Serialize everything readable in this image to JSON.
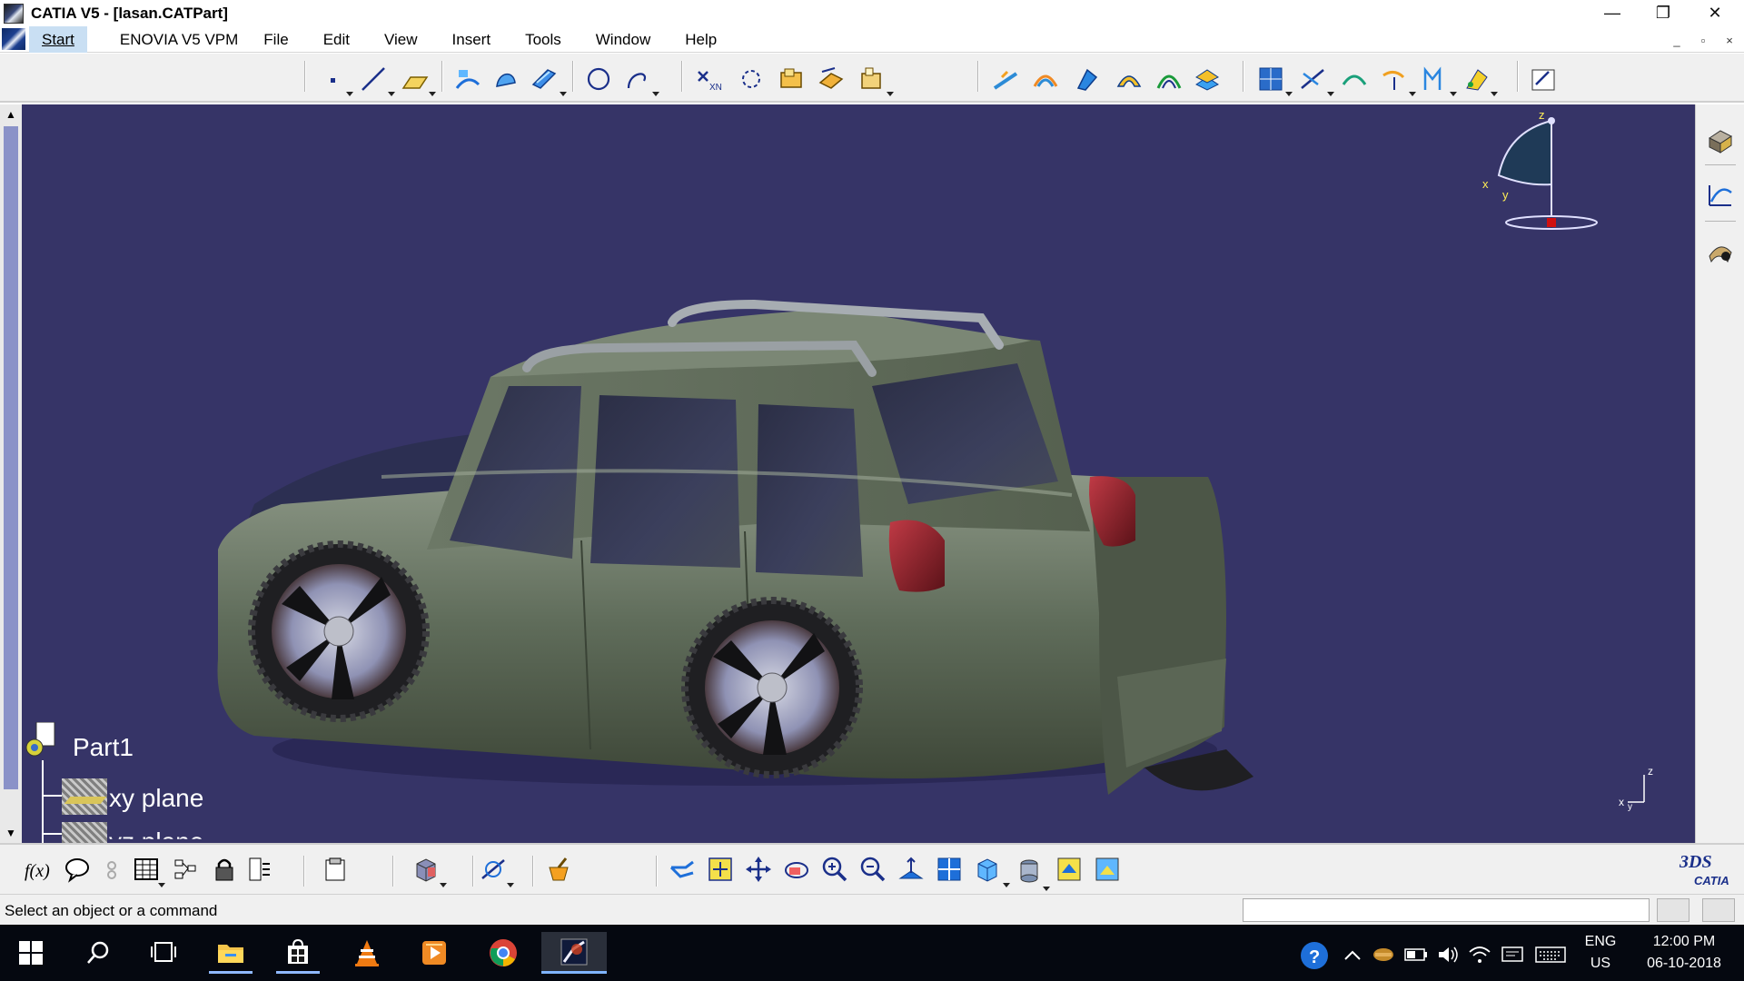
{
  "window": {
    "title": "CATIA V5 - [lasan.CATPart]",
    "minimize_glyph": "—",
    "restore_glyph": "❐",
    "close_glyph": "✕"
  },
  "menu": {
    "items": [
      "Start",
      "ENOVIA V5 VPM",
      "File",
      "Edit",
      "View",
      "Insert",
      "Tools",
      "Window",
      "Help"
    ],
    "mdi_minimize": "_",
    "mdi_restore": "▫",
    "mdi_close": "×"
  },
  "toolbar_top": {
    "icons": [
      "point-icon",
      "line-icon",
      "plane-icon",
      "extrude-surface-icon",
      "revolve-surface-icon",
      "sweep-surface-icon",
      "circle-icon",
      "spline-icon",
      "join-icon",
      "healing-icon",
      "split-icon",
      "trim-icon",
      "boundary-icon",
      "fillet-surface-icon",
      "chordal-fillet-icon",
      "translate-icon",
      "rotate-icon",
      "symmetry-icon",
      "scaling-icon",
      "extrapolate-icon",
      "offset-icon",
      "grid-icon",
      "curve-icon",
      "curve-smooth-icon",
      "sketch-curve-icon",
      "3d-curve-icon",
      "analysis-icon",
      "sketcher-icon"
    ]
  },
  "viewport": {
    "background": "#363467",
    "scroll_up": "▲",
    "scroll_down": "▼",
    "tree": {
      "root": "Part1",
      "children": [
        "xy plane",
        "yz plane"
      ]
    },
    "compass": {
      "x_label": "x",
      "y_label": "y",
      "z_label": "z"
    },
    "mini_axis": {
      "z_label": "z",
      "x_label": "x",
      "y_label": "y"
    }
  },
  "toolbar_right": {
    "icons": [
      "part-design-workbench-icon",
      "generative-shape-icon",
      "freestyle-icon"
    ]
  },
  "toolbar_bottom": {
    "icons": [
      "formula-icon",
      "comment-icon",
      "knowledge-icon",
      "table-icon",
      "parameters-icon",
      "lock-icon",
      "design-table-icon",
      "catalog-icon",
      "cube-3d-icon",
      "measure-icon",
      "apply-material-icon",
      "fly-mode-icon",
      "fit-all-icon",
      "pan-icon",
      "rotate-view-icon",
      "zoom-in-icon",
      "zoom-out-icon",
      "normal-view-icon",
      "multi-view-icon",
      "iso-view-icon",
      "shading-icon",
      "hide-show-icon",
      "swap-visible-icon"
    ],
    "logo_text": "CATIA",
    "logo_brand": "3DS"
  },
  "statusbar": {
    "message": "Select an object or a command",
    "command_value": "",
    "command_placeholder": ""
  },
  "taskbar": {
    "apps": [
      "windows-start-icon",
      "search-icon",
      "task-view-icon",
      "file-explorer-icon",
      "store-icon",
      "vlc-icon",
      "media-player-icon",
      "chrome-icon",
      "catia-icon"
    ],
    "language": "ENG",
    "region": "US",
    "time": "12:00 PM",
    "date": "06-10-2018"
  }
}
